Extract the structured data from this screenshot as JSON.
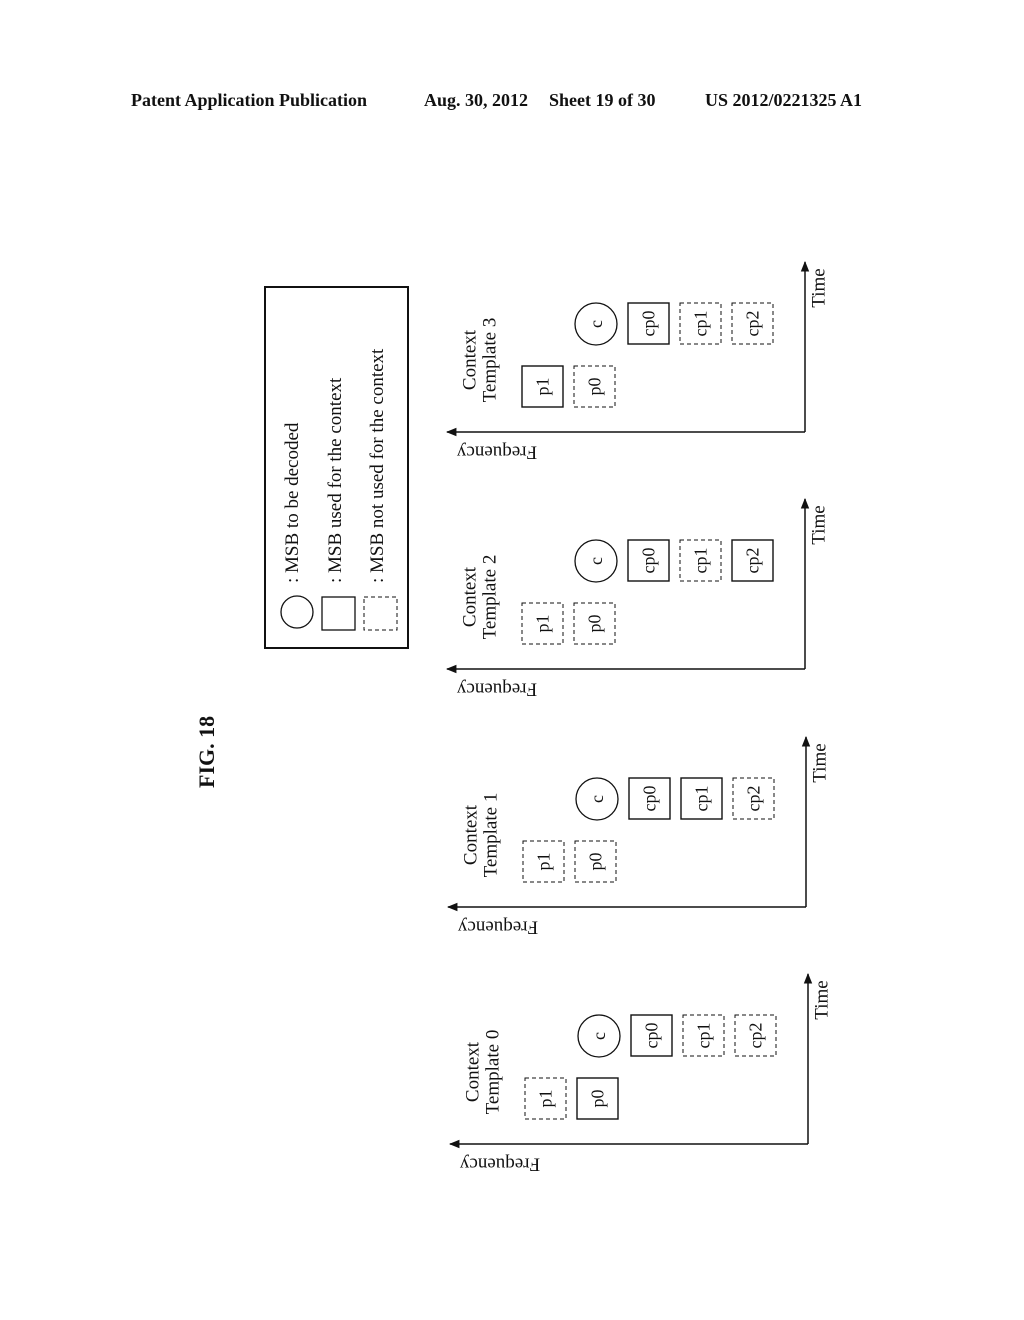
{
  "header": {
    "left": "Patent Application Publication",
    "date": "Aug. 30, 2012",
    "sheet": "Sheet 19 of 30",
    "number": "US 2012/0221325 A1"
  },
  "figure_label": "FIG. 18",
  "legend": {
    "items": [
      {
        "shape": "circle",
        "label": ": MSB to be decoded"
      },
      {
        "shape": "solid-square",
        "label": ": MSB used for the context"
      },
      {
        "shape": "dashed-square",
        "label": ": MSB not used for the context"
      }
    ]
  },
  "axes": {
    "x_label": "Time",
    "y_label": "Frequency"
  },
  "panels": [
    {
      "title_line1": "Context",
      "title_line2": "Template 3",
      "cells": {
        "p1": "solid",
        "p0": "dashed",
        "c": "circle",
        "cp0": "solid",
        "cp1": "dashed",
        "cp2": "dashed"
      }
    },
    {
      "title_line1": "Context",
      "title_line2": "Template 2",
      "cells": {
        "p1": "dashed",
        "p0": "dashed",
        "c": "circle",
        "cp0": "solid",
        "cp1": "dashed",
        "cp2": "solid"
      }
    },
    {
      "title_line1": "Context",
      "title_line2": "Template 1",
      "cells": {
        "p1": "dashed",
        "p0": "dashed",
        "c": "circle",
        "cp0": "solid",
        "cp1": "solid",
        "cp2": "dashed"
      }
    },
    {
      "title_line1": "Context",
      "title_line2": "Template 0",
      "cells": {
        "p1": "dashed",
        "p0": "solid",
        "c": "circle",
        "cp0": "solid",
        "cp1": "dashed",
        "cp2": "dashed"
      }
    }
  ]
}
